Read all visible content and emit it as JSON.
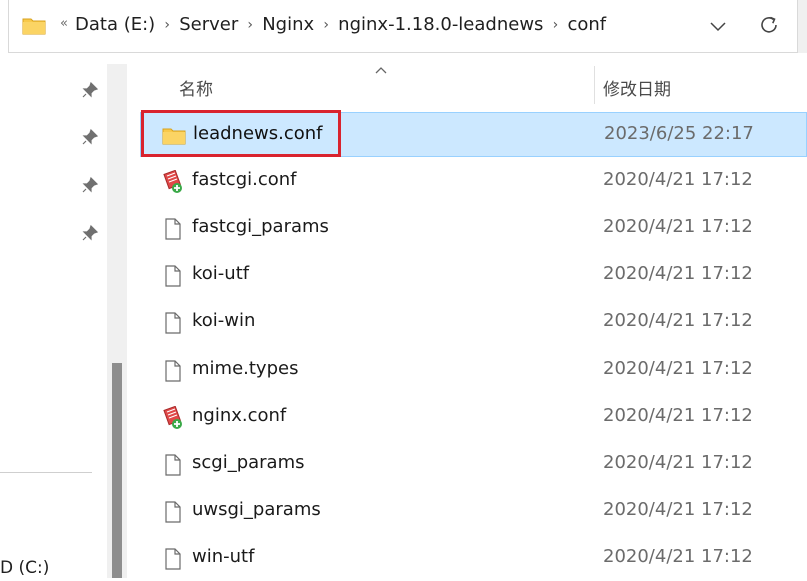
{
  "address_bar": {
    "overflow_indicator": "«",
    "breadcrumbs": [
      "Data (E:)",
      "Server",
      "Nginx",
      "nginx-1.18.0-leadnews",
      "conf"
    ],
    "separator": "›"
  },
  "columns": {
    "name": "名称",
    "date_modified": "修改日期"
  },
  "files": [
    {
      "name": "leadnews.conf",
      "date": "2023/6/25 22:17",
      "icon": "folder-icon",
      "selected": true
    },
    {
      "name": "fastcgi.conf",
      "date": "2020/4/21 17:12",
      "icon": "conf-file-icon"
    },
    {
      "name": "fastcgi_params",
      "date": "2020/4/21 17:12",
      "icon": "file-icon"
    },
    {
      "name": "koi-utf",
      "date": "2020/4/21 17:12",
      "icon": "file-icon"
    },
    {
      "name": "koi-win",
      "date": "2020/4/21 17:12",
      "icon": "file-icon"
    },
    {
      "name": "mime.types",
      "date": "2020/4/21 17:12",
      "icon": "file-icon"
    },
    {
      "name": "nginx.conf",
      "date": "2020/4/21 17:12",
      "icon": "conf-file-icon"
    },
    {
      "name": "scgi_params",
      "date": "2020/4/21 17:12",
      "icon": "file-icon"
    },
    {
      "name": "uwsgi_params",
      "date": "2020/4/21 17:12",
      "icon": "file-icon"
    },
    {
      "name": "win-utf",
      "date": "2020/4/21 17:12",
      "icon": "file-icon"
    }
  ],
  "navigation": {
    "drive_label": "D (C:)"
  },
  "colors": {
    "selection_bg": "#cce8ff",
    "selection_border": "#99d1ff",
    "highlight_annotation": "#d9232e",
    "folder_yellow": "#f8c94b"
  }
}
